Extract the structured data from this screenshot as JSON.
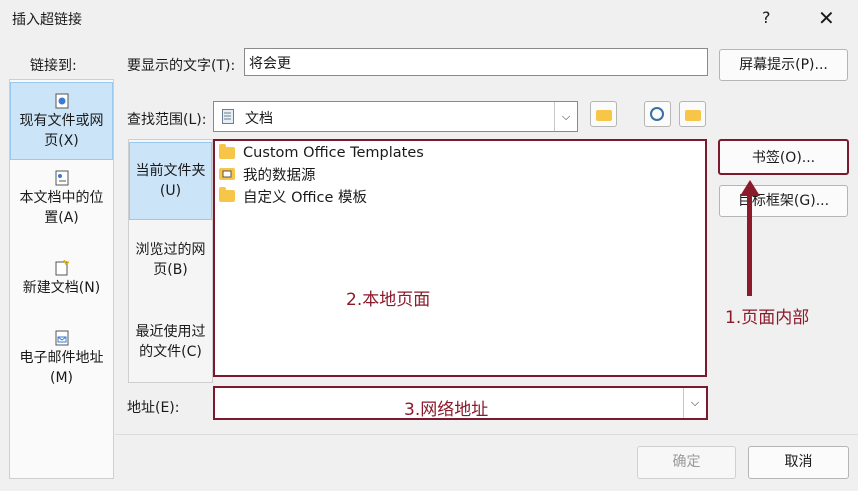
{
  "window": {
    "title": "插入超链接",
    "help": "?",
    "close": "✕"
  },
  "link_to": {
    "label": "链接到:",
    "items": [
      {
        "label_line1": "现有文件或网",
        "label_line2": "页(X)",
        "icon": "globe-page-icon"
      },
      {
        "label_line1": "本文档中的位",
        "label_line2": "置(A)",
        "icon": "document-place-icon"
      },
      {
        "label_line1": "新建文档(N)",
        "label_line2": "",
        "icon": "new-document-icon"
      },
      {
        "label_line1": "电子邮件地址",
        "label_line2": "(M)",
        "icon": "email-icon"
      }
    ]
  },
  "display_text": {
    "label": "要显示的文字(T):",
    "value": "将会更"
  },
  "screen_tip_button": "屏幕提示(P)...",
  "look_in": {
    "label": "查找范围(L):",
    "value": "文档"
  },
  "inner_tabs": [
    {
      "line1": "当前文件夹",
      "line2": "(U)"
    },
    {
      "line1": "浏览过的网",
      "line2": "页(B)"
    },
    {
      "line1": "最近使用过",
      "line2": "的文件(C)"
    }
  ],
  "files": [
    {
      "name": "Custom Office Templates",
      "icon": "folder-icon"
    },
    {
      "name": "我的数据源",
      "icon": "data-source-icon"
    },
    {
      "name": "自定义 Office 模板",
      "icon": "folder-icon"
    }
  ],
  "bookmark_button": "书签(O)...",
  "target_frame_button": "目标框架(G)...",
  "address": {
    "label": "地址(E):",
    "value": ""
  },
  "annotations": {
    "local_page": "2.本地页面",
    "page_inside": "1.页面内部",
    "web_address": "3.网络地址",
    "color": "#8b1a2b"
  },
  "ok_button": "确定",
  "cancel_button": "取消"
}
